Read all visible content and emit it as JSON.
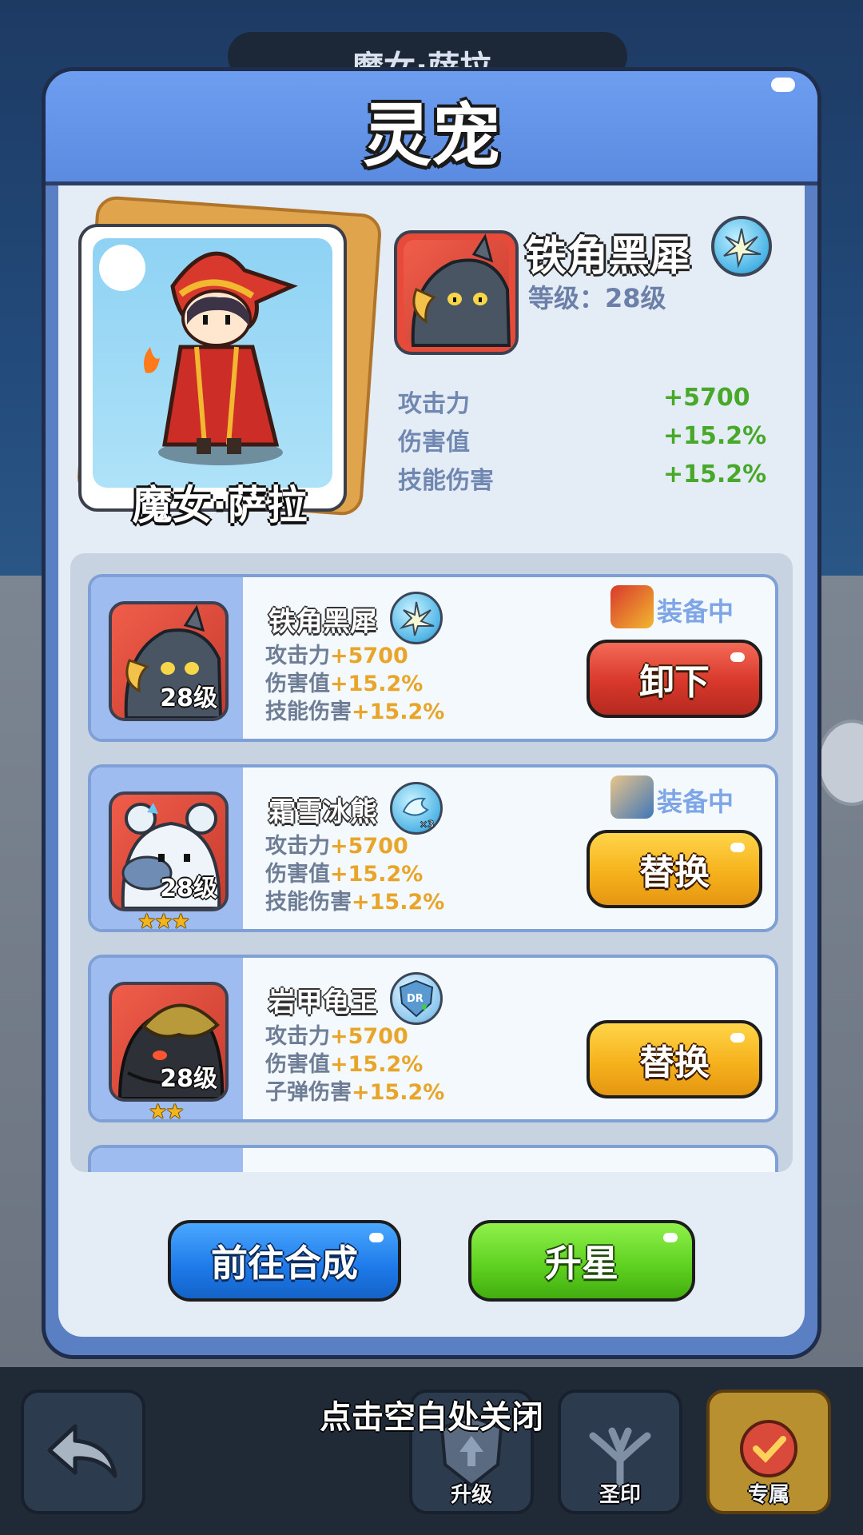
{
  "background": {
    "header_text": "魔女·萨拉",
    "toolbar": [
      {
        "label": "",
        "icon": "back-arrow-icon"
      },
      {
        "label": "升级",
        "icon": "upgrade-shield-icon"
      },
      {
        "label": "圣印",
        "icon": "tree-seal-icon"
      },
      {
        "label": "专属",
        "icon": "exclusive-badge-icon"
      }
    ]
  },
  "dialog": {
    "title": "灵宠",
    "hero_name": "魔女·萨拉",
    "selected_pet": {
      "name": "铁角黑犀",
      "level_text": "等级：28级",
      "stats": [
        {
          "label": "攻击力",
          "value": "+5700"
        },
        {
          "label": "伤害值",
          "value": "+15.2%"
        },
        {
          "label": "技能伤害",
          "value": "+15.2%"
        }
      ]
    },
    "pets": [
      {
        "name": "铁角黑犀",
        "level": "28级",
        "stars": 0,
        "status": "装备中",
        "stats": [
          {
            "label": "攻击力",
            "value": "+5700"
          },
          {
            "label": "伤害值",
            "value": "+15.2%"
          },
          {
            "label": "技能伤害",
            "value": "+15.2%"
          }
        ],
        "button": "卸下"
      },
      {
        "name": "霜雪冰熊",
        "level": "28级",
        "stars": 3,
        "status": "装备中",
        "badge_text": "×3",
        "stats": [
          {
            "label": "攻击力",
            "value": "+5700"
          },
          {
            "label": "伤害值",
            "value": "+15.2%"
          },
          {
            "label": "技能伤害",
            "value": "+15.2%"
          }
        ],
        "button": "替换"
      },
      {
        "name": "岩甲龟王",
        "level": "28级",
        "stars": 2,
        "status": "",
        "badge_text": "DR",
        "stats": [
          {
            "label": "攻击力",
            "value": "+5700"
          },
          {
            "label": "伤害值",
            "value": "+15.2%"
          },
          {
            "label": "子弹伤害",
            "value": "+15.2%"
          }
        ],
        "button": "替换"
      }
    ],
    "footer": {
      "synth_label": "前往合成",
      "star_label": "升星"
    }
  },
  "close_hint": "点击空白处关闭",
  "colors": {
    "stat_green": "#47a82a",
    "stat_orange": "#e8a52a",
    "dialog_blue": "#5b8be0"
  }
}
